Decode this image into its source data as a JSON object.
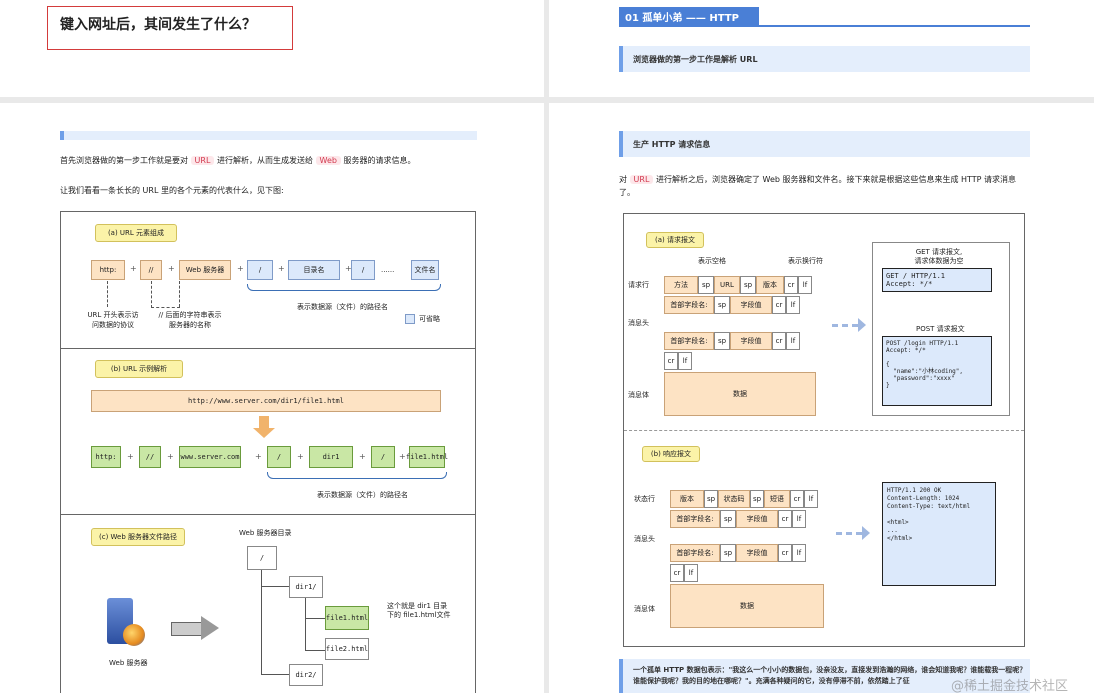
{
  "top_left": {
    "title": "键入网址后，其间发生了什么？"
  },
  "top_right": {
    "section_title": "01 孤单小弟 —— HTTP",
    "sub_heading": "浏览器做的第一步工作是解析 URL"
  },
  "left_page": {
    "para1_a": "首先浏览器做的第一步工作就是要对",
    "para1_url": "URL",
    "para1_b": "进行解析，从而生成发送给",
    "para1_web": "Web",
    "para1_c": "服务器的请求信息。",
    "para2": "让我们看看一条长长的 URL 里的各个元素的代表什么，见下图:",
    "fig_a": {
      "label": "(a)  URL 元素组成",
      "boxes": [
        "http:",
        "//",
        "Web 服务器",
        "/",
        "目录名",
        "/",
        "文件名"
      ],
      "dots": "......",
      "note1": "URL 开头表示访\n问数据的协议",
      "note2": "// 后面的字符串表示\n服务器的名称",
      "note3": "表示数据源（文件）的路径名",
      "legend": "可省略"
    },
    "fig_b": {
      "label": "(b)  URL 示例解析",
      "url": "http://www.server.com/dir1/file1.html",
      "boxes": [
        "http:",
        "//",
        "www.server.com",
        "/",
        "dir1",
        "/",
        "file1.html"
      ],
      "note": "表示数据源（文件）的路径名"
    },
    "fig_c": {
      "label": "(c)  Web 服务器文件路径",
      "root_title": "Web 服务器目录",
      "root": "/",
      "dir1": "dir1/",
      "file1": "file1.html",
      "file2": "file2.html",
      "dir2": "dir2/",
      "note": "这个就是 dir1 目录\n下的 file1.html文件",
      "server": "Web 服务器"
    }
  },
  "right_page": {
    "heading": "生产 HTTP 请求信息",
    "para_a": "对",
    "para_url": "URL",
    "para_b": "进行解析之后，浏览器确定了 Web 服务器和文件名。接下来就是根据这些信息来生成 HTTP 请求消息了。",
    "req": {
      "label": "(a) 请求报文",
      "top1": "表示空格",
      "top2": "表示换行符",
      "row_labels": [
        "请求行",
        "消息头",
        "消息体"
      ],
      "line": [
        "方法",
        "sp",
        "URL",
        "sp",
        "版本",
        "cr",
        "lf"
      ],
      "hdr": [
        "首部字段名:",
        "sp",
        "字段值",
        "cr",
        "lf"
      ],
      "crlf": [
        "cr",
        "lf"
      ],
      "body": "数据",
      "get_title": "GET 请求报文,\n请求体数据为空",
      "get_text": "GET / HTTP/1.1\nAccept: */*",
      "post_title": "POST 请求报文",
      "post_text": "POST /login HTTP/1.1\nAccept: */*\n\n{\n  \"name\":\"小林coding\",\n  \"password\":\"xxxx\"\n}"
    },
    "resp": {
      "label": "(b) 响应报文",
      "row_labels": [
        "状态行",
        "消息头",
        "消息体"
      ],
      "line": [
        "版本",
        "sp",
        "状态码",
        "sp",
        "短语",
        "cr",
        "lf"
      ],
      "hdr": [
        "首部字段名:",
        "sp",
        "字段值",
        "cr",
        "lf"
      ],
      "crlf": [
        "cr",
        "lf"
      ],
      "body": "数据",
      "text": "HTTP/1.1 200 OK\nContent-Length: 1024\nContent-Type: text/html\n\n<html>\n...\n</html>"
    },
    "footer": "一个孤单 HTTP 数据包表示：\"我这么一个小小的数据包，没亲没友，直接发到浩瀚的网络，谁会知道我呢？谁能载我一程呢？谁能保护我呢？我的目的地在哪呢？\"。充满各种疑问的它，没有停滞不前，依然踏上了征"
  },
  "watermark": "@稀土掘金技术社区",
  "colors": {
    "accent": "#4a7fd6",
    "red_frame": "#d33b3b"
  }
}
